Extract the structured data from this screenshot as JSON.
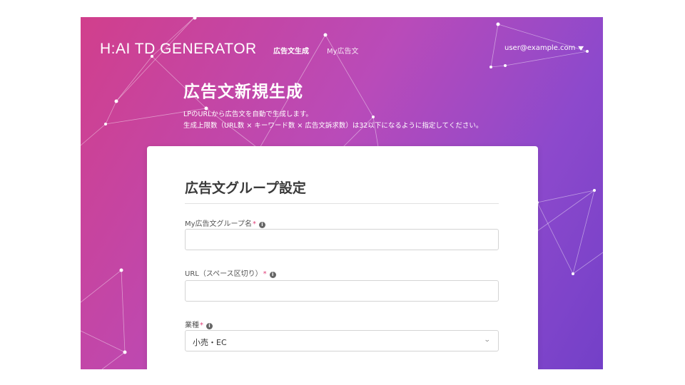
{
  "header": {
    "logo": "H:AI TD GENERATOR",
    "nav": [
      {
        "label": "広告文生成",
        "active": true
      },
      {
        "label": "My広告文",
        "active": false
      }
    ],
    "user": {
      "email": "user@example.com",
      "icon": "chevron-down-icon"
    }
  },
  "page": {
    "title": "広告文新規生成",
    "description": [
      "LPのURLから広告文を自動で生成します。",
      "生成上限数（URL数 × キーワード数 × 広告文訴求数）は32以下になるように指定してください。"
    ]
  },
  "form": {
    "title": "広告文グループ設定",
    "fields": [
      {
        "label": "My広告文グループ名",
        "required_mark": "*",
        "info_icon": "i",
        "value": "",
        "placeholder": ""
      },
      {
        "label": "URL（スペース区切り）",
        "required_mark": "*",
        "info_icon": "i",
        "value": "",
        "placeholder": ""
      },
      {
        "label": "業種",
        "required_mark": "*",
        "info_icon": "i",
        "selected": "小売・EC"
      }
    ]
  },
  "colors": {
    "gradient_start": "#d13f8c",
    "gradient_end": "#7340c8",
    "required": "#e0407a",
    "card_background": "#ffffff"
  }
}
